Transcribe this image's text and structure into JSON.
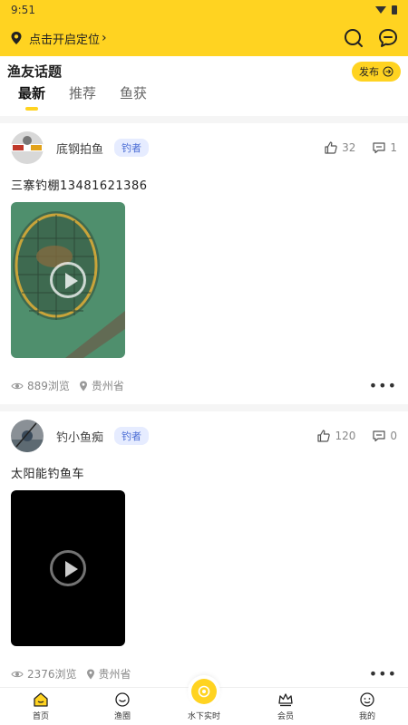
{
  "status_bar": {
    "time": "9:51"
  },
  "top_bar": {
    "location_label": "点击开启定位"
  },
  "section": {
    "title": "渔友话题",
    "publish_label": "发布"
  },
  "tabs": [
    {
      "label": "最新",
      "active": true
    },
    {
      "label": "推荐",
      "active": false
    },
    {
      "label": "鱼获",
      "active": false
    }
  ],
  "posts": [
    {
      "username": "底钢拍鱼",
      "role": "钓者",
      "likes": "32",
      "comments": "1",
      "text": "三寨钓棚13481621386",
      "views": "889浏览",
      "location": "贵州省"
    },
    {
      "username": "钓小鱼痴",
      "role": "钓者",
      "likes": "120",
      "comments": "0",
      "text": "太阳能钓鱼车",
      "views": "2376浏览",
      "location": "贵州省"
    }
  ],
  "bottom_nav": [
    {
      "label": "首页",
      "icon": "home-icon"
    },
    {
      "label": "渔圈",
      "icon": "circle-icon"
    },
    {
      "label": "水下实时",
      "icon": "camera-icon"
    },
    {
      "label": "会员",
      "icon": "crown-icon"
    },
    {
      "label": "我的",
      "icon": "profile-icon"
    }
  ],
  "colors": {
    "accent": "#ffd321",
    "badge_bg": "#e6ecff",
    "badge_text": "#4a6cd4"
  }
}
